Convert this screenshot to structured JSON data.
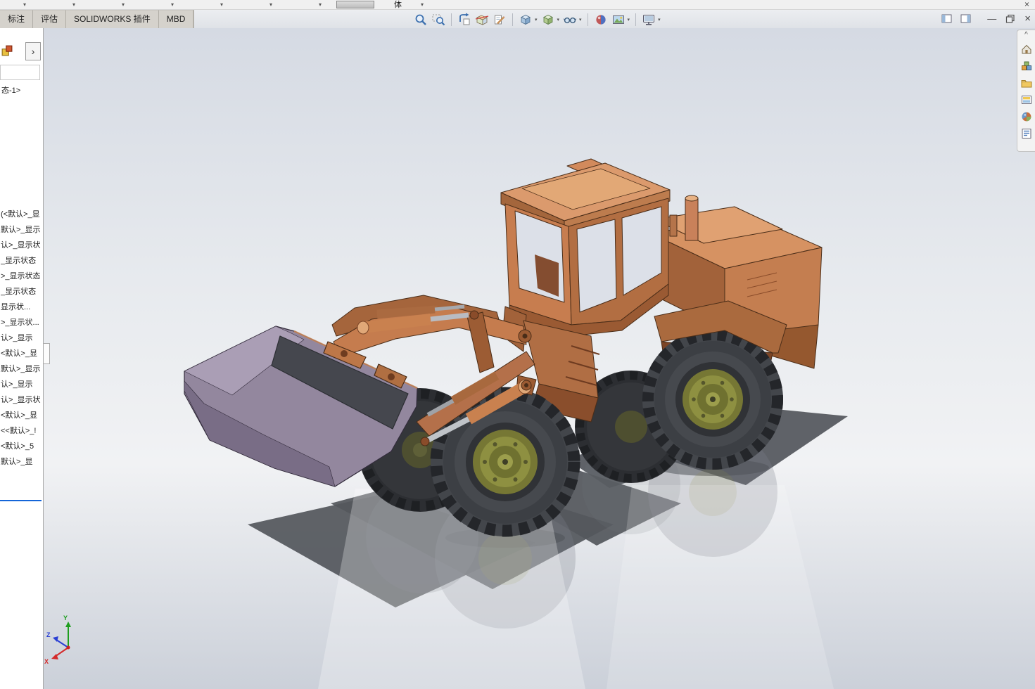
{
  "window": {
    "menu_carets": [
      "▾",
      "▾",
      "▾",
      "▾",
      "▾",
      "▾",
      "▾"
    ],
    "document_label": "体",
    "doc_caret": "▾",
    "row1_close": "×",
    "minimize": "—",
    "close": "×"
  },
  "command_manager": {
    "tabs": [
      {
        "label": "标注"
      },
      {
        "label": "评估"
      },
      {
        "label": "SOLIDWORKS 插件"
      },
      {
        "label": "MBD"
      }
    ]
  },
  "headsup_toolbar": {
    "caret": "▾",
    "icons": [
      "zoom-to-fit",
      "zoom-to-area",
      "previous-view",
      "section-view",
      "dynamic-annotation-views",
      "view-orientation",
      "display-style",
      "hide-show-items",
      "edit-appearance",
      "apply-scene",
      "view-settings"
    ]
  },
  "feature_tree": {
    "expand_arrow": "›",
    "header": "态-1>",
    "items": [
      "(<默认>_显",
      "默认>_显示",
      "认>_显示状",
      "_显示状态",
      ">_显示状态",
      "_显示状态",
      "显示状...",
      ">_显示状...",
      "认>_显示",
      "<默认>_显",
      "默认>_显示",
      "认>_显示",
      "认>_显示状",
      "<默认>_显",
      "<<默认>_!",
      "<默认>_5",
      "默认>_显"
    ],
    "rollback_color": "#1565d8"
  },
  "task_pane": {
    "collapse_arrow": "^",
    "icons": [
      "solidworks-resources",
      "design-library",
      "file-explorer",
      "view-palette",
      "appearances-scenes",
      "custom-properties"
    ]
  },
  "viewport": {
    "triad": {
      "x": "X",
      "y": "Y",
      "z": "Z"
    },
    "model": {
      "name": "wheel-loader-assembly",
      "body_color": "#c1764a",
      "bucket_color": "#93879e",
      "tire_color": "#3c3f44",
      "hub_color": "#8f9142",
      "shadow_color": "#54575d",
      "background_top": "#d5dae3",
      "background_bottom": "#cbd0d9"
    }
  }
}
